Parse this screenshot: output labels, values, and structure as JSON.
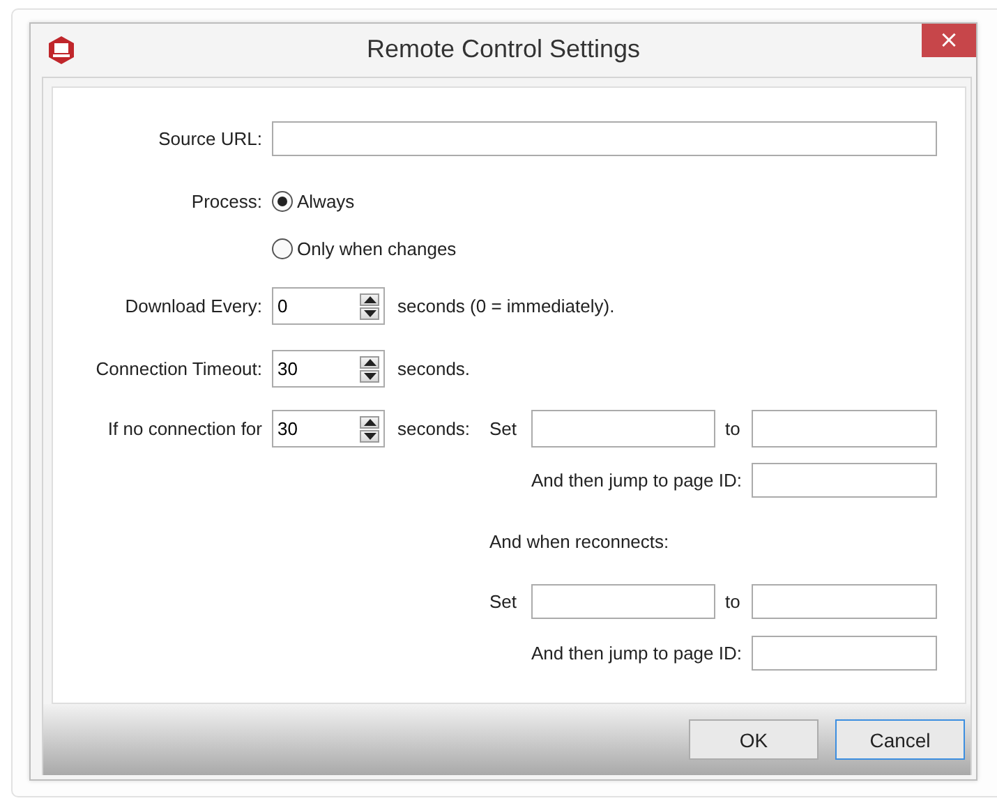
{
  "window": {
    "title": "Remote Control Settings",
    "close": "×"
  },
  "source_url": {
    "label": "Source URL:"
  },
  "process": {
    "label": "Process:",
    "options": [
      {
        "label": "Always",
        "selected": true
      },
      {
        "label": "Only when changes",
        "selected": false
      }
    ]
  },
  "download_every": {
    "label": "Download Every:",
    "value": "0",
    "suffix": "seconds (0 = immediately)."
  },
  "connection_timeout": {
    "label": "Connection Timeout:",
    "value": "30",
    "suffix": "seconds."
  },
  "no_connection": {
    "label": "If no connection for",
    "value": "30",
    "suffix": "seconds:",
    "set_label": "Set",
    "to_label": "to",
    "jump_label": "And then jump to page ID:"
  },
  "reconnect": {
    "heading": "And when reconnects:",
    "set_label": "Set",
    "to_label": "to",
    "jump_label": "And then jump to page ID:"
  },
  "buttons": [
    {
      "label": "OK",
      "focused": false
    },
    {
      "label": "Cancel",
      "focused": true
    }
  ]
}
